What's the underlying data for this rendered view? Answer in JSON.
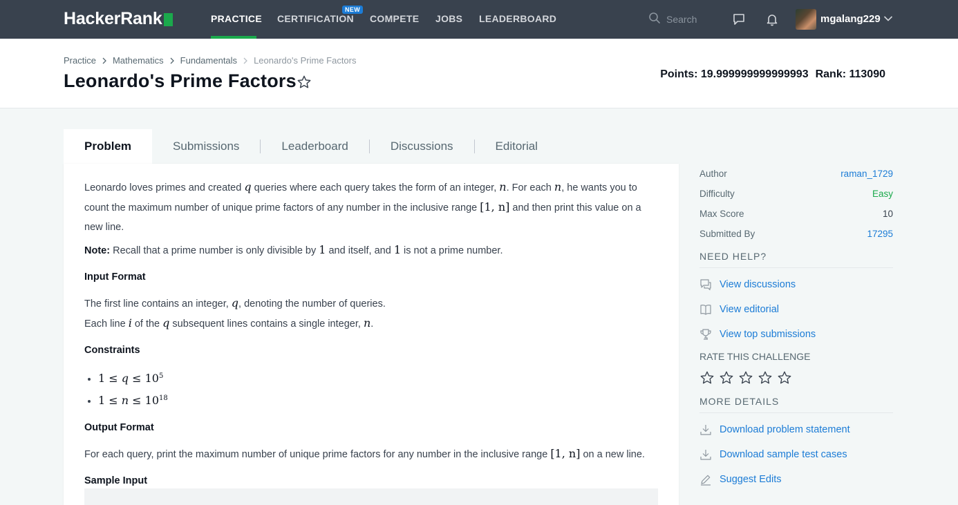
{
  "nav": {
    "logo_text": "HackerRank",
    "items": [
      {
        "label": "PRACTICE"
      },
      {
        "label": "CERTIFICATION"
      },
      {
        "label": "COMPETE"
      },
      {
        "label": "JOBS"
      },
      {
        "label": "LEADERBOARD"
      }
    ],
    "new_badge": "NEW",
    "search_placeholder": "Search",
    "username": "mgalang229"
  },
  "header": {
    "breadcrumb": [
      "Practice",
      "Mathematics",
      "Fundamentals",
      "Leonardo's Prime Factors"
    ],
    "title": "Leonardo's Prime Factors",
    "points": "Points: 19.999999999999993",
    "rank": "Rank: 113090"
  },
  "tabs": [
    "Problem",
    "Submissions",
    "Leaderboard",
    "Discussions",
    "Editorial"
  ],
  "problem": {
    "intro_1": "Leonardo loves primes and created ",
    "q": "q",
    "intro_2": " queries where each query takes the form of an integer, ",
    "n": "n",
    "intro_3": ". For each ",
    "intro_4": ", he wants you to count the maximum number of unique prime factors of any number in the inclusive range ",
    "range": "[1, n]",
    "intro_5": " and then print this value on a new line.",
    "note_label": "Note:",
    "note_1": " Recall that a prime number is only divisible by ",
    "one": "1",
    "note_2": " and itself, and ",
    "note_3": " is not a prime number.",
    "input_heading": "Input Format",
    "input_1a": "The first line contains an integer, ",
    "input_1b": ", denoting the number of queries.",
    "input_2a": "Each line ",
    "i": "i",
    "input_2b": " of the ",
    "input_2c": " subsequent lines contains a single integer, ",
    "period": ".",
    "constraints_heading": "Constraints",
    "c1_left": "1 ≤ ",
    "c1_right": " ≤ 10",
    "c1_exp": "5",
    "c2_left": "1 ≤ ",
    "c2_right": " ≤ 10",
    "c2_exp": "18",
    "output_heading": "Output Format",
    "output_1": "For each query, print the maximum number of unique prime factors for any number in the inclusive range ",
    "output_2": " on a new line.",
    "sample_heading": "Sample Input"
  },
  "sidebar": {
    "author_label": "Author",
    "author_value": "raman_1729",
    "difficulty_label": "Difficulty",
    "difficulty_value": "Easy",
    "maxscore_label": "Max Score",
    "maxscore_value": "10",
    "submitted_label": "Submitted By",
    "submitted_value": "17295",
    "need_help": "NEED HELP?",
    "help_links": [
      "View discussions",
      "View editorial",
      "View top submissions"
    ],
    "rate_heading": "RATE THIS CHALLENGE",
    "more_details": "MORE DETAILS",
    "detail_links": [
      "Download problem statement",
      "Download sample test cases",
      "Suggest Edits"
    ]
  },
  "colors": {
    "nav_bg": "#39424e",
    "brand_green": "#1ba94c",
    "link_blue": "#1c7cd6"
  }
}
